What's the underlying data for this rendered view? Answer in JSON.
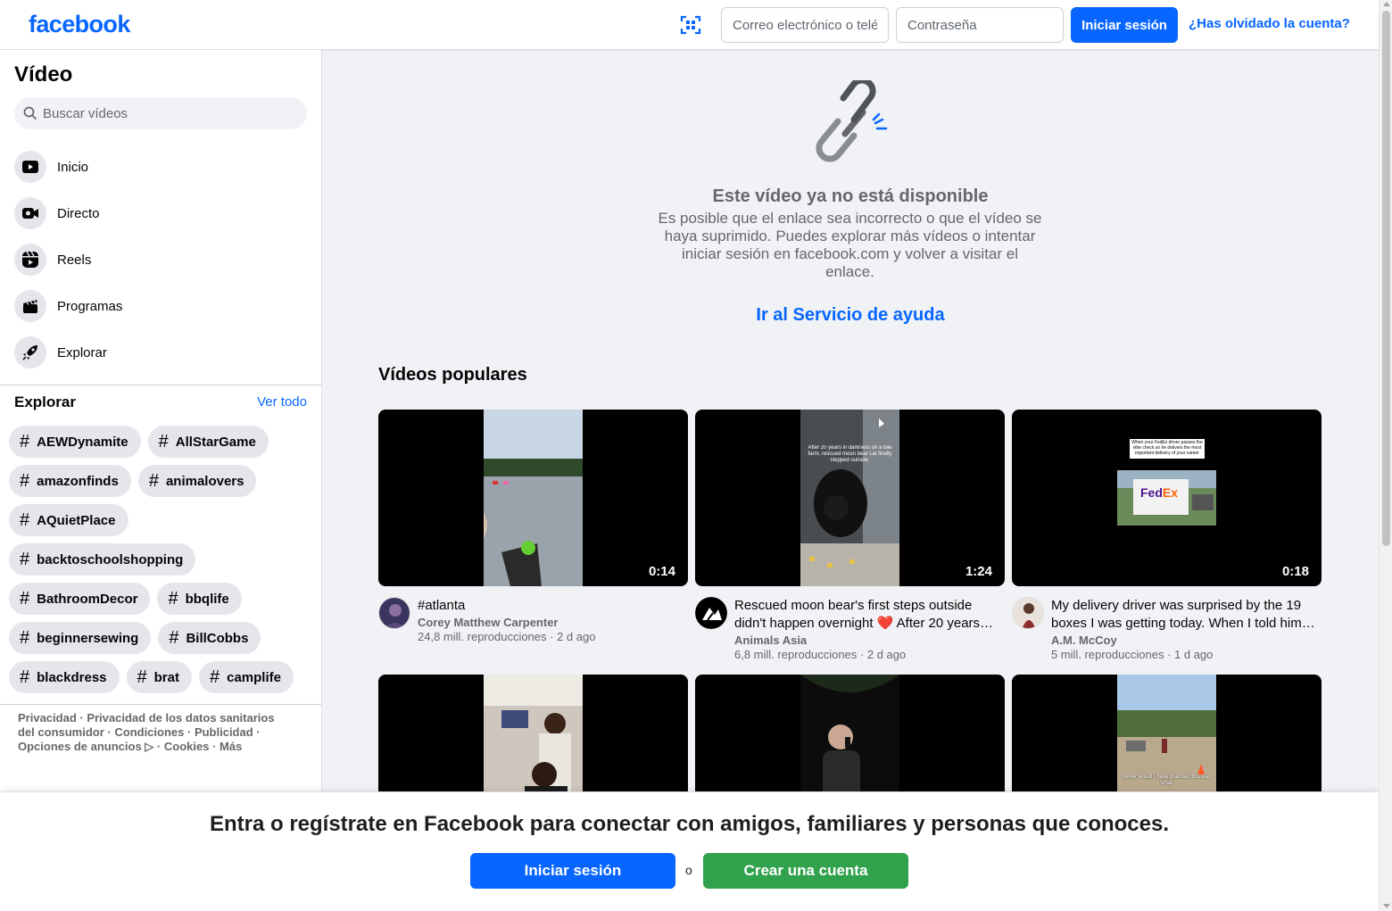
{
  "header": {
    "logo": "facebook",
    "email_placeholder": "Correo electrónico o teléfono",
    "password_placeholder": "Contraseña",
    "login_label": "Iniciar sesión",
    "forgot_label": "¿Has olvidado la cuenta?"
  },
  "sidebar": {
    "title": "Vídeo",
    "search_placeholder": "Buscar vídeos",
    "nav": [
      {
        "label": "Inicio",
        "icon": "play-icon"
      },
      {
        "label": "Directo",
        "icon": "live-camera-icon"
      },
      {
        "label": "Reels",
        "icon": "reels-icon"
      },
      {
        "label": "Programas",
        "icon": "clapperboard-icon"
      },
      {
        "label": "Explorar",
        "icon": "rocket-icon"
      }
    ],
    "explore_title": "Explorar",
    "see_all": "Ver todo",
    "tags": [
      "AEWDynamite",
      "AllStarGame",
      "amazonfinds",
      "animalovers",
      "AQuietPlace",
      "backtoschoolshopping",
      "BathroomDecor",
      "bbqlife",
      "beginnersewing",
      "BillCobbs",
      "blackdress",
      "brat",
      "camplife"
    ],
    "footer": [
      "Privacidad",
      "Privacidad de los datos sanitarios del consumidor",
      "Condiciones",
      "Publicidad",
      "Opciones de anuncios ▷",
      "Cookies",
      "Más"
    ]
  },
  "main": {
    "unavailable_title": "Este vídeo ya no está disponible",
    "unavailable_desc": "Es posible que el enlace sea incorrecto o que el vídeo se haya suprimido. Puedes explorar más vídeos o intentar iniciar sesión en facebook.com y volver a visitar el enlace.",
    "help_link": "Ir al Servicio de ayuda",
    "popular_title": "Vídeos populares",
    "videos": [
      {
        "title": "#atlanta",
        "author": "Corey Matthew Carpenter",
        "views": "24,8 mill. reproducciones",
        "age": "2 d ago",
        "duration": "0:14"
      },
      {
        "title": "Rescued moon bear's first steps outside didn't happen overnight ❤️ After 20 years o…",
        "author": "Animals Asia",
        "views": "6,8 mill. reproducciones",
        "age": "2 d ago",
        "duration": "1:24"
      },
      {
        "title": "My delivery driver was surprised by the 19 boxes I was getting today. When I told him…",
        "author": "A.M. McCoy",
        "views": "5 mill. reproducciones",
        "age": "1 d ago",
        "duration": "0:18"
      },
      {
        "title": "",
        "author": "",
        "views": "",
        "age": "",
        "duration": ""
      },
      {
        "title": "",
        "author": "",
        "views": "",
        "age": "",
        "duration": ""
      },
      {
        "title": "",
        "author": "",
        "views": "",
        "age": "",
        "duration": ""
      }
    ],
    "thumb_texts": {
      "bear": "After 20 years in darkness on a bile farm, rescued moon bear Lai finally stepped outside.",
      "fedex_caption": "When your FedEx driver passes the vibe check so he delivers the most important delivery of your career",
      "fedex_logo": "FedEx",
      "field_caption": "Never would I have guessed this was what"
    }
  },
  "banner": {
    "text": "Entra o regístrate en Facebook para conectar con amigos, familiares y personas que conoces.",
    "login_label": "Iniciar sesión",
    "or_label": "o",
    "create_label": "Crear una cuenta"
  },
  "colors": {
    "brand": "#0866ff",
    "create_green": "#31a24c",
    "secondary_text": "#65676b"
  }
}
